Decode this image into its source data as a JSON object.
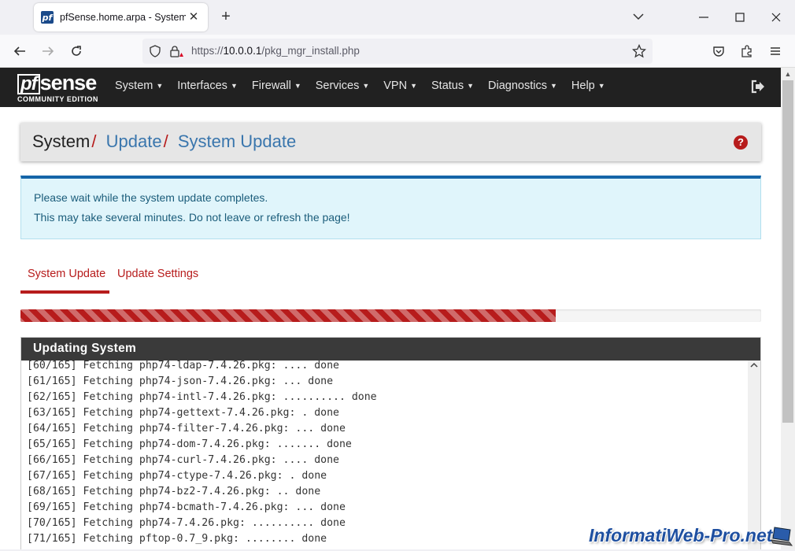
{
  "browser": {
    "tab_title": "pfSense.home.arpa - System: Update",
    "favicon_text": "pf",
    "url_prefix": "https://",
    "url_host": "10.0.0.1",
    "url_path": "/pkg_mgr_install.php"
  },
  "header": {
    "logo_pf": "pf",
    "logo_sense": "sense",
    "logo_sub": "COMMUNITY EDITION",
    "menu": [
      "System",
      "Interfaces",
      "Firewall",
      "Services",
      "VPN",
      "Status",
      "Diagnostics",
      "Help"
    ]
  },
  "breadcrumb": {
    "root": "System",
    "sep": "/",
    "level1": "Update",
    "level2": "System Update",
    "help": "?"
  },
  "alert": {
    "line1": "Please wait while the system update completes.",
    "line2": "This may take several minutes. Do not leave or refresh the page!"
  },
  "tabs": [
    "System Update",
    "Update Settings"
  ],
  "progress": {
    "percent": 72.3
  },
  "log": {
    "heading": "Updating System",
    "lines": [
      "[60/165] Fetching php74-ldap-7.4.26.pkg: .... done",
      "[61/165] Fetching php74-json-7.4.26.pkg: ... done",
      "[62/165] Fetching php74-intl-7.4.26.pkg: .......... done",
      "[63/165] Fetching php74-gettext-7.4.26.pkg: . done",
      "[64/165] Fetching php74-filter-7.4.26.pkg: ... done",
      "[65/165] Fetching php74-dom-7.4.26.pkg: ....... done",
      "[66/165] Fetching php74-curl-7.4.26.pkg: .... done",
      "[67/165] Fetching php74-ctype-7.4.26.pkg: . done",
      "[68/165] Fetching php74-bz2-7.4.26.pkg: .. done",
      "[69/165] Fetching php74-bcmath-7.4.26.pkg: ... done",
      "[70/165] Fetching php74-7.4.26.pkg: .......... done",
      "[71/165] Fetching pftop-0.7_9.pkg: ........ done"
    ]
  },
  "watermark": "InformatiWeb-Pro.net",
  "colors": {
    "accent": "#b71c1c",
    "link": "#3a76ad",
    "header_bg": "#212121",
    "alert_bg": "#e0f5fb"
  }
}
